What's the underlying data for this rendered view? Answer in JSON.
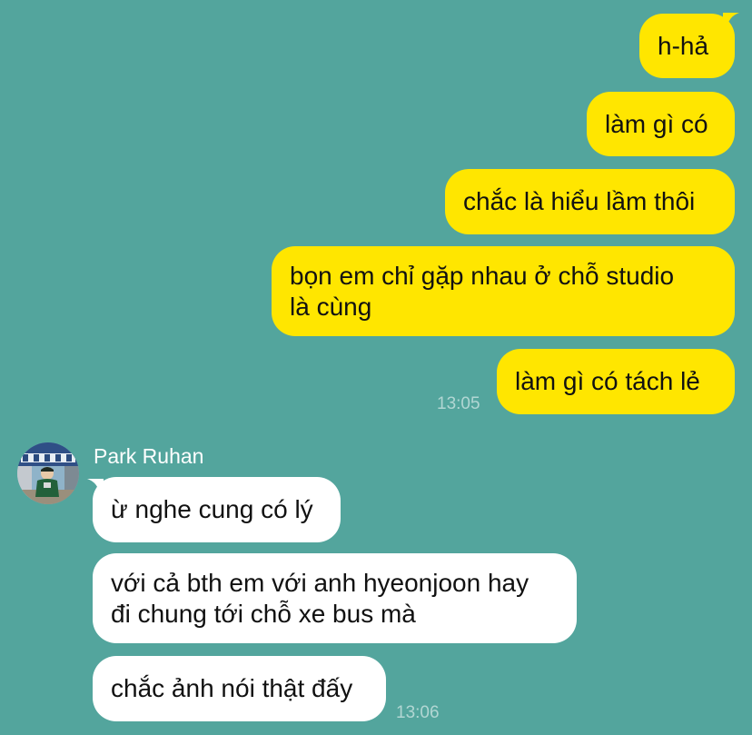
{
  "outgoing_messages": [
    {
      "text": "h-hả"
    },
    {
      "text": "làm gì có"
    },
    {
      "text": "chắc là hiểu lầm thôi"
    },
    {
      "lines": [
        "bọn em chỉ gặp nhau ở chỗ studio",
        "là cùng"
      ]
    },
    {
      "text": "làm gì có tách lẻ"
    }
  ],
  "outgoing_time": "13:05",
  "contact": {
    "name": "Park Ruhan",
    "avatar_icon": "profile-photo"
  },
  "incoming_messages": [
    {
      "text": "ừ nghe cung có lý"
    },
    {
      "lines": [
        "với cả bth em với anh hyeonjoon hay",
        "đi chung tới chỗ xe bus mà"
      ]
    },
    {
      "text": "chắc ảnh nói thật đấy"
    }
  ],
  "incoming_time": "13:06",
  "colors": {
    "background": "#53a59d",
    "outgoing_bubble": "#ffe600",
    "incoming_bubble": "#ffffff"
  }
}
